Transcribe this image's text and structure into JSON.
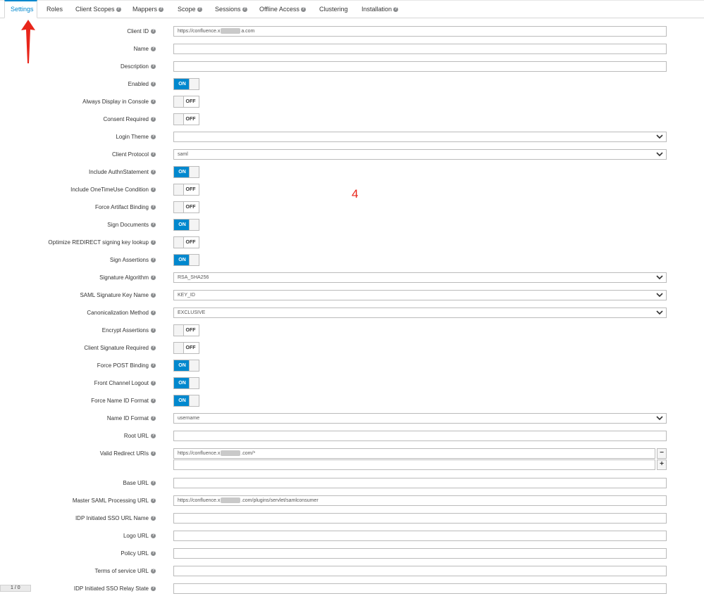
{
  "tabs": [
    {
      "label": "Settings",
      "help": false,
      "active": true
    },
    {
      "label": "Roles",
      "help": false
    },
    {
      "label": "Client Scopes",
      "help": true
    },
    {
      "label": "Mappers",
      "help": true
    },
    {
      "label": "Scope",
      "help": true
    },
    {
      "label": "Sessions",
      "help": true
    },
    {
      "label": "Offline Access",
      "help": true
    },
    {
      "label": "Clustering",
      "help": false
    },
    {
      "label": "Installation",
      "help": true
    }
  ],
  "annotation_number": "4",
  "fields": [
    {
      "key": "client_id",
      "label": "Client ID",
      "type": "text",
      "value_pre": "https://confluence.x",
      "value_post": "a.com",
      "blurred": true
    },
    {
      "key": "name",
      "label": "Name",
      "type": "text",
      "value": ""
    },
    {
      "key": "description",
      "label": "Description",
      "type": "text",
      "value": ""
    },
    {
      "key": "enabled",
      "label": "Enabled",
      "type": "toggle",
      "on": true
    },
    {
      "key": "always_display",
      "label": "Always Display in Console",
      "type": "toggle",
      "on": false
    },
    {
      "key": "consent_required",
      "label": "Consent Required",
      "type": "toggle",
      "on": false
    },
    {
      "key": "login_theme",
      "label": "Login Theme",
      "type": "select",
      "value": ""
    },
    {
      "key": "client_protocol",
      "label": "Client Protocol",
      "type": "select",
      "value": "saml"
    },
    {
      "key": "include_authn",
      "label": "Include AuthnStatement",
      "type": "toggle",
      "on": true
    },
    {
      "key": "include_onetimeuse",
      "label": "Include OneTimeUse Condition",
      "type": "toggle",
      "on": false
    },
    {
      "key": "force_artifact",
      "label": "Force Artifact Binding",
      "type": "toggle",
      "on": false
    },
    {
      "key": "sign_documents",
      "label": "Sign Documents",
      "type": "toggle",
      "on": true
    },
    {
      "key": "optimize_redirect",
      "label": "Optimize REDIRECT signing key lookup",
      "type": "toggle",
      "on": false
    },
    {
      "key": "sign_assertions",
      "label": "Sign Assertions",
      "type": "toggle",
      "on": true
    },
    {
      "key": "signature_algorithm",
      "label": "Signature Algorithm",
      "type": "select",
      "value": "RSA_SHA256"
    },
    {
      "key": "saml_sig_key_name",
      "label": "SAML Signature Key Name",
      "type": "select",
      "value": "KEY_ID"
    },
    {
      "key": "canonicalization",
      "label": "Canonicalization Method",
      "type": "select",
      "value": "EXCLUSIVE"
    },
    {
      "key": "encrypt_assertions",
      "label": "Encrypt Assertions",
      "type": "toggle",
      "on": false
    },
    {
      "key": "client_sig_required",
      "label": "Client Signature Required",
      "type": "toggle",
      "on": false
    },
    {
      "key": "force_post",
      "label": "Force POST Binding",
      "type": "toggle",
      "on": true
    },
    {
      "key": "front_channel_logout",
      "label": "Front Channel Logout",
      "type": "toggle",
      "on": true
    },
    {
      "key": "force_name_id",
      "label": "Force Name ID Format",
      "type": "toggle",
      "on": true
    },
    {
      "key": "name_id_format",
      "label": "Name ID Format",
      "type": "select",
      "value": "username"
    },
    {
      "key": "root_url",
      "label": "Root URL",
      "type": "text",
      "value": ""
    },
    {
      "key": "valid_redirect",
      "label": "Valid Redirect URIs",
      "type": "multi",
      "value_pre": "https://confluence.x",
      "value_post": ".com/*",
      "blurred": true
    },
    {
      "key": "base_url",
      "label": "Base URL",
      "type": "text",
      "value": ""
    },
    {
      "key": "master_saml",
      "label": "Master SAML Processing URL",
      "type": "text",
      "value_pre": "https://confluence.x",
      "value_post": ".com/plugins/servlet/samlconsumer",
      "blurred": true
    },
    {
      "key": "idp_sso_name",
      "label": "IDP Initiated SSO URL Name",
      "type": "text",
      "value": ""
    },
    {
      "key": "logo_url",
      "label": "Logo URL",
      "type": "text",
      "value": ""
    },
    {
      "key": "policy_url",
      "label": "Policy URL",
      "type": "text",
      "value": ""
    },
    {
      "key": "tos_url",
      "label": "Terms of service URL",
      "type": "text",
      "value": ""
    },
    {
      "key": "idp_relay",
      "label": "IDP Initiated SSO Relay State",
      "type": "text",
      "value": ""
    }
  ],
  "toggle_text": {
    "on": "ON",
    "off": "OFF"
  },
  "multi_buttons": {
    "remove": "−",
    "add": "+"
  },
  "pager_text": "1 / 0",
  "colors": {
    "accent": "#0088ce",
    "annotation": "#e8251a"
  }
}
